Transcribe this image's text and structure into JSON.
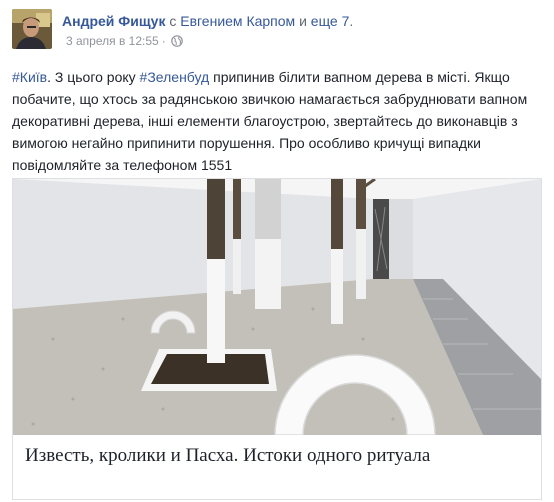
{
  "post": {
    "author_name": "Андрей Фищук",
    "with_word": "с",
    "tagged_person": "Евгением Карпом",
    "and_word": "и",
    "others": "еще 7",
    "period": ".",
    "timestamp": "3 апреля в 12:55",
    "separator": "·",
    "privacy_icon": "globe-icon",
    "text": {
      "tag_kyiv": "#Київ",
      "part1": ". З цього року ",
      "tag_zelenbud": "#Зеленбуд",
      "part2": " припинив білити вапном дерева в місті. Якщо побачите, що хтось за радянською звичкою намагається забруднювати вапном декоративні дерева, інші елементи благоустрою, звертайтесь до виконавців з вимогою негайно припинити порушення. Про особливо кричущі випадки повідомляйте за телефоном 1551"
    }
  },
  "attachment": {
    "image_icon": "photo-gallery-trees-tires",
    "title": "Известь, кролики и Пасха. Истоки одного ритуала"
  },
  "colors": {
    "link": "#365899",
    "text": "#1d2129",
    "meta": "#90949c",
    "border": "#dddfe2"
  }
}
